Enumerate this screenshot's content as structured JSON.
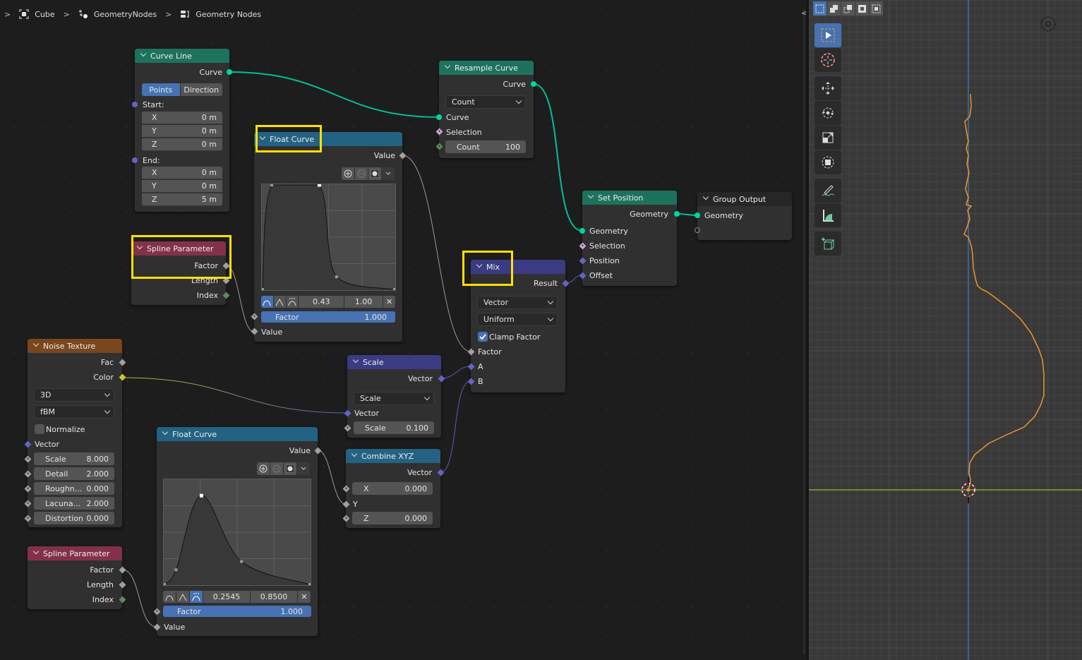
{
  "breadcrumb": {
    "items": [
      {
        "label": "Cube",
        "icon": "object-icon"
      },
      {
        "label": "GeometryNodes",
        "icon": "modifier-nodes-icon"
      },
      {
        "label": "Geometry Nodes",
        "icon": "node-tree-icon"
      }
    ]
  },
  "nodes": {
    "curve_line": {
      "title": "Curve Line",
      "output": "Curve",
      "mode_options": [
        "Points",
        "Direction"
      ],
      "mode_selected": "Points",
      "start_label": "Start:",
      "start": [
        {
          "axis": "X",
          "value": "0 m"
        },
        {
          "axis": "Y",
          "value": "0 m"
        },
        {
          "axis": "Z",
          "value": "0 m"
        }
      ],
      "end_label": "End:",
      "end": [
        {
          "axis": "X",
          "value": "0 m"
        },
        {
          "axis": "Y",
          "value": "0 m"
        },
        {
          "axis": "Z",
          "value": "5 m"
        }
      ]
    },
    "float_curve_1": {
      "title": "Float Curve",
      "output": "Value",
      "handle_x": "0.43",
      "handle_y": "1.00",
      "factor_label": "Factor",
      "factor_value": "1.000",
      "input": "Value",
      "points": [
        [
          0.0,
          0.0
        ],
        [
          0.07,
          1.0
        ],
        [
          0.43,
          1.0
        ],
        [
          0.56,
          0.12
        ],
        [
          1.0,
          0.0
        ]
      ]
    },
    "spline_param_1": {
      "title": "Spline Parameter",
      "outputs": [
        "Factor",
        "Length",
        "Index"
      ]
    },
    "resample_curve": {
      "title": "Resample Curve",
      "output": "Curve",
      "mode": "Count",
      "inputs": [
        "Curve",
        "Selection"
      ],
      "count_label": "Count",
      "count_value": "100"
    },
    "mix": {
      "title": "Mix",
      "output": "Result",
      "data_type": "Vector",
      "factor_mode": "Uniform",
      "clamp_label": "Clamp Factor",
      "clamp_checked": true,
      "inputs": [
        "Factor",
        "A",
        "B"
      ]
    },
    "set_position": {
      "title": "Set Position",
      "output": "Geometry",
      "inputs": [
        "Geometry",
        "Selection",
        "Position",
        "Offset"
      ]
    },
    "group_output": {
      "title": "Group Output",
      "inputs": [
        "Geometry"
      ]
    },
    "noise_texture": {
      "title": "Noise Texture",
      "outputs": [
        "Fac",
        "Color"
      ],
      "dimensions": "3D",
      "noise_type": "fBM",
      "normalize_label": "Normalize",
      "normalize_checked": false,
      "vector_label": "Vector",
      "fields": [
        {
          "label": "Scale",
          "value": "8.000"
        },
        {
          "label": "Detail",
          "value": "2.000"
        },
        {
          "label": "Roughn...",
          "value": "0.000"
        },
        {
          "label": "Lacuna...",
          "value": "2.000"
        },
        {
          "label": "Distortion",
          "value": "0.000"
        }
      ]
    },
    "float_curve_2": {
      "title": "Float Curve",
      "output": "Value",
      "handle_x": "0.2545",
      "handle_y": "0.8500",
      "factor_label": "Factor",
      "factor_value": "1.000",
      "input": "Value",
      "points": [
        [
          0.0,
          0.0
        ],
        [
          0.08,
          0.14
        ],
        [
          0.2545,
          0.85
        ],
        [
          0.53,
          0.22
        ],
        [
          1.0,
          0.0
        ]
      ]
    },
    "scale": {
      "title": "Scale",
      "output": "Vector",
      "operation": "Scale",
      "vector_label": "Vector",
      "scale_label": "Scale",
      "scale_value": "0.100"
    },
    "combine_xyz": {
      "title": "Combine XYZ",
      "output": "Vector",
      "x_label": "X",
      "x_value": "0.000",
      "y_label": "Y",
      "z_label": "Z",
      "z_value": "0.000"
    },
    "spline_param_2": {
      "title": "Spline Parameter",
      "outputs": [
        "Factor",
        "Length",
        "Index"
      ]
    }
  },
  "viewport": {
    "tools": [
      "select-box",
      "cursor",
      "move",
      "rotate",
      "scale",
      "transform",
      "annotate",
      "measure",
      "add-cube"
    ],
    "active_tool": "select-box",
    "select_modes": [
      "new",
      "extend",
      "subtract",
      "difference",
      "intersect"
    ],
    "active_select_mode": "new"
  },
  "colors": {
    "geometry_socket": "#00d6a3",
    "float_socket": "#a1a1a1",
    "vector_socket": "#6363c7",
    "color_socket": "#c7c729",
    "int_socket": "#598c5c",
    "bool_socket": "#cca6d6",
    "accent": "#4772b3",
    "curve_preview": "#f0952a",
    "highlight": "#ffe100"
  }
}
